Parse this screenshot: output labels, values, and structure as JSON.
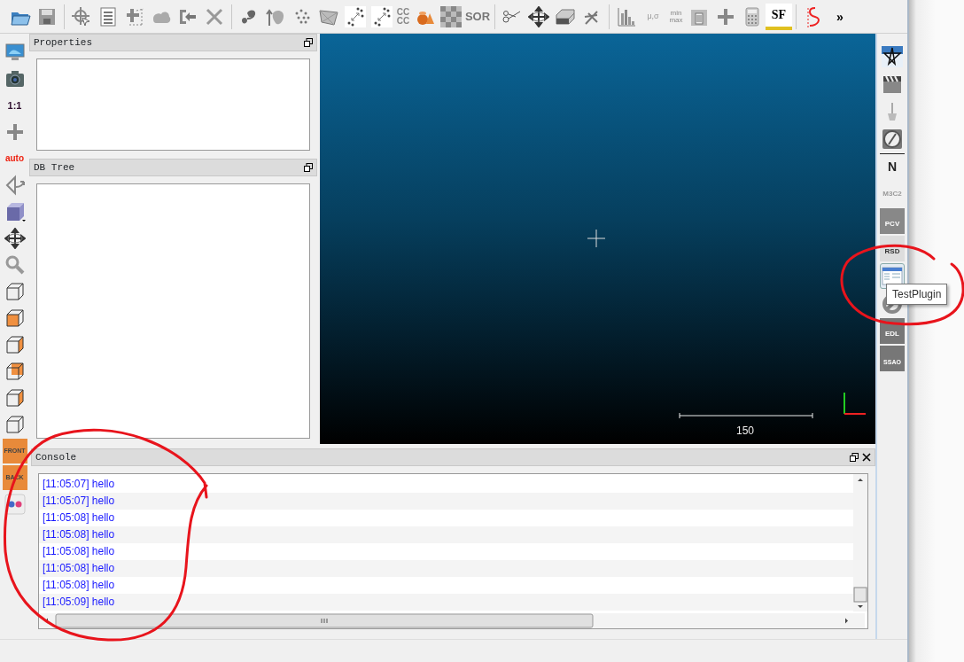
{
  "main_toolbar": [
    {
      "kind": "folder"
    },
    {
      "kind": "floppy"
    },
    {
      "kind": "separator"
    },
    {
      "kind": "crosshair"
    },
    {
      "kind": "list"
    },
    {
      "kind": "dashed-plus"
    },
    {
      "kind": "cloud"
    },
    {
      "kind": "box-arrow"
    },
    {
      "kind": "cross"
    },
    {
      "kind": "separator"
    },
    {
      "kind": "blob"
    },
    {
      "kind": "leaf-arrow"
    },
    {
      "kind": "dots"
    },
    {
      "kind": "mesh"
    },
    {
      "kind": "dots-arrow"
    },
    {
      "kind": "dots-arrow"
    },
    {
      "kind": "text",
      "label": "CC CC"
    },
    {
      "kind": "shapes"
    },
    {
      "kind": "checker"
    },
    {
      "kind": "text",
      "label": "SOR"
    },
    {
      "kind": "separator"
    },
    {
      "kind": "scissors"
    },
    {
      "kind": "move"
    },
    {
      "kind": "slab"
    },
    {
      "kind": "tool"
    },
    {
      "kind": "separator"
    },
    {
      "kind": "histogram"
    },
    {
      "kind": "text",
      "label": "μ,σ"
    },
    {
      "kind": "text",
      "label": "min max"
    },
    {
      "kind": "trash"
    },
    {
      "kind": "plus"
    },
    {
      "kind": "calculator"
    },
    {
      "kind": "text",
      "label": "SF"
    },
    {
      "kind": "separator"
    },
    {
      "kind": "curve"
    },
    {
      "kind": "text",
      "label": "»"
    }
  ],
  "left_toolbar": [
    {
      "kind": "monitor"
    },
    {
      "kind": "camera"
    },
    {
      "kind": "text",
      "label": "1:1"
    },
    {
      "kind": "plus"
    },
    {
      "kind": "text",
      "label": "auto"
    },
    {
      "kind": "rotate"
    },
    {
      "kind": "cube"
    },
    {
      "kind": "move"
    },
    {
      "kind": "magnifier"
    },
    {
      "kind": "wire-cube"
    },
    {
      "kind": "front-cube"
    },
    {
      "kind": "side-cube"
    },
    {
      "kind": "top-cube"
    },
    {
      "kind": "side-cube"
    },
    {
      "kind": "wire-cube"
    },
    {
      "kind": "text",
      "label": "FRONT"
    },
    {
      "kind": "text",
      "label": "BACK"
    },
    {
      "kind": "dots-pair"
    }
  ],
  "panels": [
    {
      "title": "Properties"
    },
    {
      "title": "DB Tree"
    }
  ],
  "viewport": {
    "scale_label": "150"
  },
  "right_toolbar": [
    {
      "kind": "star",
      "highlighted": false
    },
    {
      "kind": "clapper",
      "highlighted": false
    },
    {
      "kind": "shovel",
      "highlighted": false
    },
    {
      "kind": "compass",
      "highlighted": false
    },
    {
      "kind": "text",
      "label": "N",
      "highlighted": false
    },
    {
      "kind": "text",
      "label": "M3C2",
      "highlighted": false
    },
    {
      "kind": "text",
      "label": "PCV",
      "highlighted": false
    },
    {
      "kind": "text",
      "label": "RSD",
      "highlighted": false
    },
    {
      "kind": "window",
      "highlighted": true
    },
    {
      "kind": "no-sign",
      "highlighted": false
    },
    {
      "kind": "text",
      "label": "EDL",
      "highlighted": false
    },
    {
      "kind": "text",
      "label": "SSAO",
      "highlighted": false
    }
  ],
  "tooltip": "TestPlugin",
  "console": {
    "title": "Console",
    "lines": [
      "[11:05:07] hello",
      "[11:05:07] hello",
      "[11:05:08] hello",
      "[11:05:08] hello",
      "[11:05:08] hello",
      "[11:05:08] hello",
      "[11:05:08] hello",
      "[11:05:09] hello"
    ]
  },
  "annotations": [
    {
      "kind": "circle"
    },
    {
      "kind": "circle"
    }
  ]
}
